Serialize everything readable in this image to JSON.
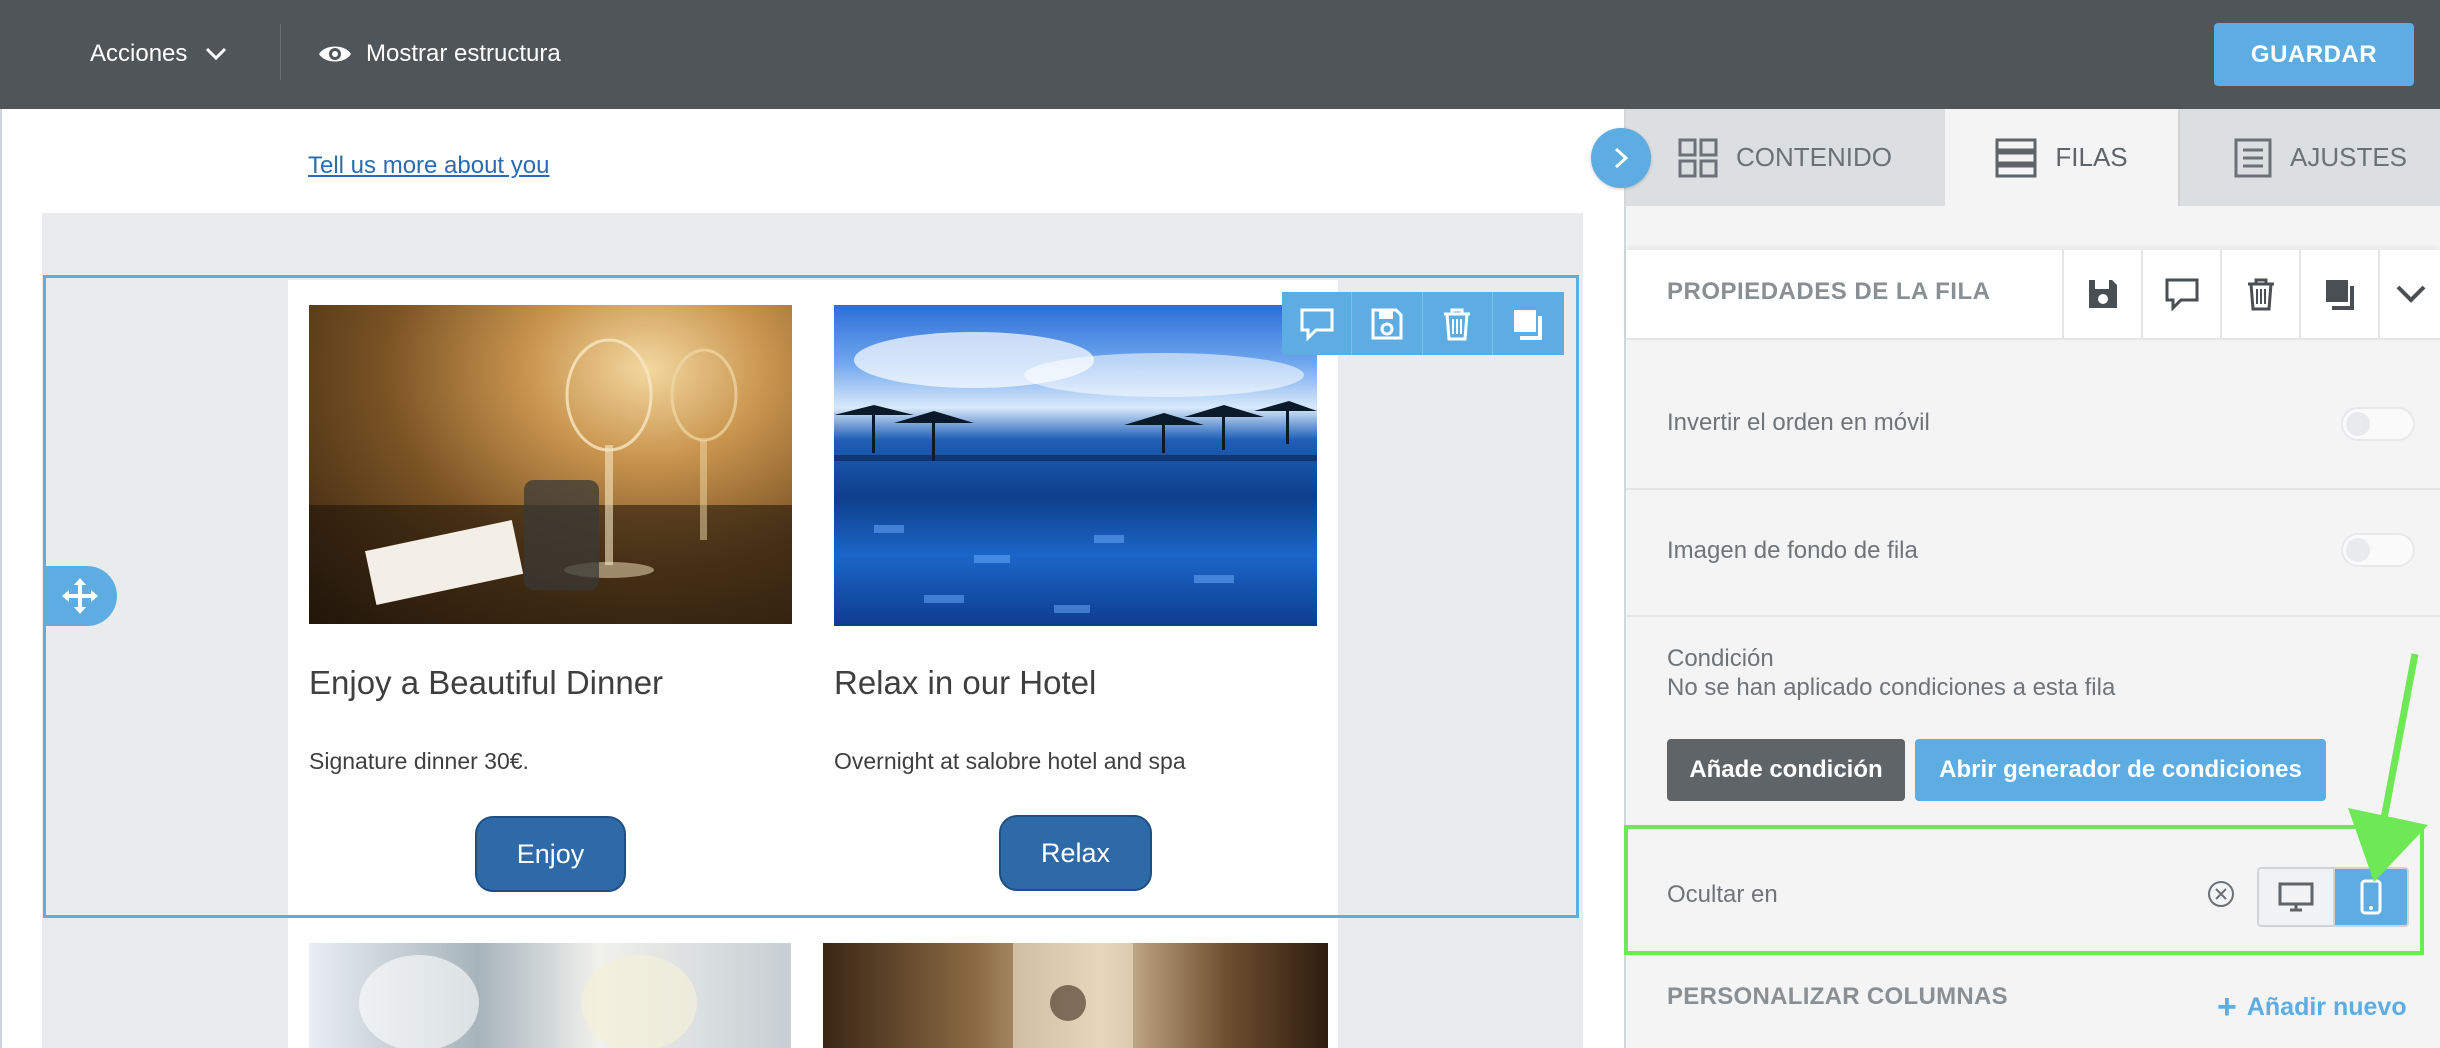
{
  "topbar": {
    "actions_label": "Acciones",
    "structure_label": "Mostrar estructura",
    "save_label": "GUARDAR"
  },
  "canvas": {
    "link_text": "Tell us more about you",
    "cards": [
      {
        "title": "Enjoy a Beautiful Dinner",
        "text": "Signature dinner 30€.",
        "button": "Enjoy"
      },
      {
        "title": "Relax in our Hotel",
        "text": "Overnight at salobre hotel and spa",
        "button": "Relax"
      }
    ]
  },
  "panel": {
    "tabs": [
      {
        "label": "CONTENIDO"
      },
      {
        "label": "FILAS",
        "active": true
      },
      {
        "label": "AJUSTES"
      }
    ],
    "section_title": "PROPIEDADES DE LA FILA",
    "settings": {
      "reverse_mobile": {
        "label": "Invertir el orden en móvil",
        "enabled": false
      },
      "row_background": {
        "label": "Imagen de fondo de fila",
        "enabled": false
      },
      "condition": {
        "label": "Condición",
        "description": "No se han aplicado condiciones a esta fila",
        "add_button": "Añade condición",
        "builder_button": "Abrir generador de condiciones"
      },
      "hide_on": {
        "label": "Ocultar en",
        "selected": "mobile"
      }
    },
    "customize_columns": "PERSONALIZAR COLUMNAS",
    "add_new": "Añadir nuevo"
  },
  "colors": {
    "topbar": "#505559",
    "accent": "#5dade2",
    "cta": "#2d6aa7",
    "highlight": "#6ee855"
  }
}
